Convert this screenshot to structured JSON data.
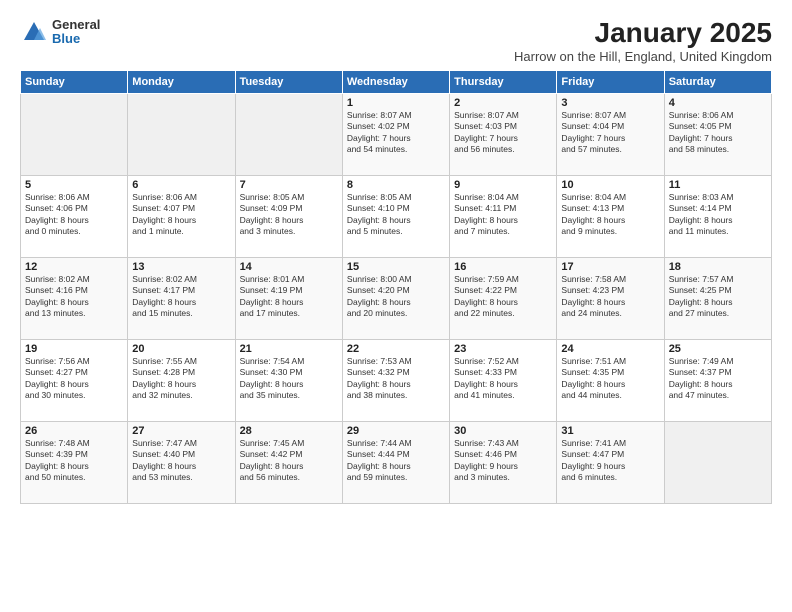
{
  "logo": {
    "general": "General",
    "blue": "Blue"
  },
  "title": {
    "main": "January 2025",
    "sub": "Harrow on the Hill, England, United Kingdom"
  },
  "weekdays": [
    "Sunday",
    "Monday",
    "Tuesday",
    "Wednesday",
    "Thursday",
    "Friday",
    "Saturday"
  ],
  "weeks": [
    [
      {
        "day": "",
        "info": ""
      },
      {
        "day": "",
        "info": ""
      },
      {
        "day": "",
        "info": ""
      },
      {
        "day": "1",
        "info": "Sunrise: 8:07 AM\nSunset: 4:02 PM\nDaylight: 7 hours\nand 54 minutes."
      },
      {
        "day": "2",
        "info": "Sunrise: 8:07 AM\nSunset: 4:03 PM\nDaylight: 7 hours\nand 56 minutes."
      },
      {
        "day": "3",
        "info": "Sunrise: 8:07 AM\nSunset: 4:04 PM\nDaylight: 7 hours\nand 57 minutes."
      },
      {
        "day": "4",
        "info": "Sunrise: 8:06 AM\nSunset: 4:05 PM\nDaylight: 7 hours\nand 58 minutes."
      }
    ],
    [
      {
        "day": "5",
        "info": "Sunrise: 8:06 AM\nSunset: 4:06 PM\nDaylight: 8 hours\nand 0 minutes."
      },
      {
        "day": "6",
        "info": "Sunrise: 8:06 AM\nSunset: 4:07 PM\nDaylight: 8 hours\nand 1 minute."
      },
      {
        "day": "7",
        "info": "Sunrise: 8:05 AM\nSunset: 4:09 PM\nDaylight: 8 hours\nand 3 minutes."
      },
      {
        "day": "8",
        "info": "Sunrise: 8:05 AM\nSunset: 4:10 PM\nDaylight: 8 hours\nand 5 minutes."
      },
      {
        "day": "9",
        "info": "Sunrise: 8:04 AM\nSunset: 4:11 PM\nDaylight: 8 hours\nand 7 minutes."
      },
      {
        "day": "10",
        "info": "Sunrise: 8:04 AM\nSunset: 4:13 PM\nDaylight: 8 hours\nand 9 minutes."
      },
      {
        "day": "11",
        "info": "Sunrise: 8:03 AM\nSunset: 4:14 PM\nDaylight: 8 hours\nand 11 minutes."
      }
    ],
    [
      {
        "day": "12",
        "info": "Sunrise: 8:02 AM\nSunset: 4:16 PM\nDaylight: 8 hours\nand 13 minutes."
      },
      {
        "day": "13",
        "info": "Sunrise: 8:02 AM\nSunset: 4:17 PM\nDaylight: 8 hours\nand 15 minutes."
      },
      {
        "day": "14",
        "info": "Sunrise: 8:01 AM\nSunset: 4:19 PM\nDaylight: 8 hours\nand 17 minutes."
      },
      {
        "day": "15",
        "info": "Sunrise: 8:00 AM\nSunset: 4:20 PM\nDaylight: 8 hours\nand 20 minutes."
      },
      {
        "day": "16",
        "info": "Sunrise: 7:59 AM\nSunset: 4:22 PM\nDaylight: 8 hours\nand 22 minutes."
      },
      {
        "day": "17",
        "info": "Sunrise: 7:58 AM\nSunset: 4:23 PM\nDaylight: 8 hours\nand 24 minutes."
      },
      {
        "day": "18",
        "info": "Sunrise: 7:57 AM\nSunset: 4:25 PM\nDaylight: 8 hours\nand 27 minutes."
      }
    ],
    [
      {
        "day": "19",
        "info": "Sunrise: 7:56 AM\nSunset: 4:27 PM\nDaylight: 8 hours\nand 30 minutes."
      },
      {
        "day": "20",
        "info": "Sunrise: 7:55 AM\nSunset: 4:28 PM\nDaylight: 8 hours\nand 32 minutes."
      },
      {
        "day": "21",
        "info": "Sunrise: 7:54 AM\nSunset: 4:30 PM\nDaylight: 8 hours\nand 35 minutes."
      },
      {
        "day": "22",
        "info": "Sunrise: 7:53 AM\nSunset: 4:32 PM\nDaylight: 8 hours\nand 38 minutes."
      },
      {
        "day": "23",
        "info": "Sunrise: 7:52 AM\nSunset: 4:33 PM\nDaylight: 8 hours\nand 41 minutes."
      },
      {
        "day": "24",
        "info": "Sunrise: 7:51 AM\nSunset: 4:35 PM\nDaylight: 8 hours\nand 44 minutes."
      },
      {
        "day": "25",
        "info": "Sunrise: 7:49 AM\nSunset: 4:37 PM\nDaylight: 8 hours\nand 47 minutes."
      }
    ],
    [
      {
        "day": "26",
        "info": "Sunrise: 7:48 AM\nSunset: 4:39 PM\nDaylight: 8 hours\nand 50 minutes."
      },
      {
        "day": "27",
        "info": "Sunrise: 7:47 AM\nSunset: 4:40 PM\nDaylight: 8 hours\nand 53 minutes."
      },
      {
        "day": "28",
        "info": "Sunrise: 7:45 AM\nSunset: 4:42 PM\nDaylight: 8 hours\nand 56 minutes."
      },
      {
        "day": "29",
        "info": "Sunrise: 7:44 AM\nSunset: 4:44 PM\nDaylight: 8 hours\nand 59 minutes."
      },
      {
        "day": "30",
        "info": "Sunrise: 7:43 AM\nSunset: 4:46 PM\nDaylight: 9 hours\nand 3 minutes."
      },
      {
        "day": "31",
        "info": "Sunrise: 7:41 AM\nSunset: 4:47 PM\nDaylight: 9 hours\nand 6 minutes."
      },
      {
        "day": "",
        "info": ""
      }
    ]
  ]
}
